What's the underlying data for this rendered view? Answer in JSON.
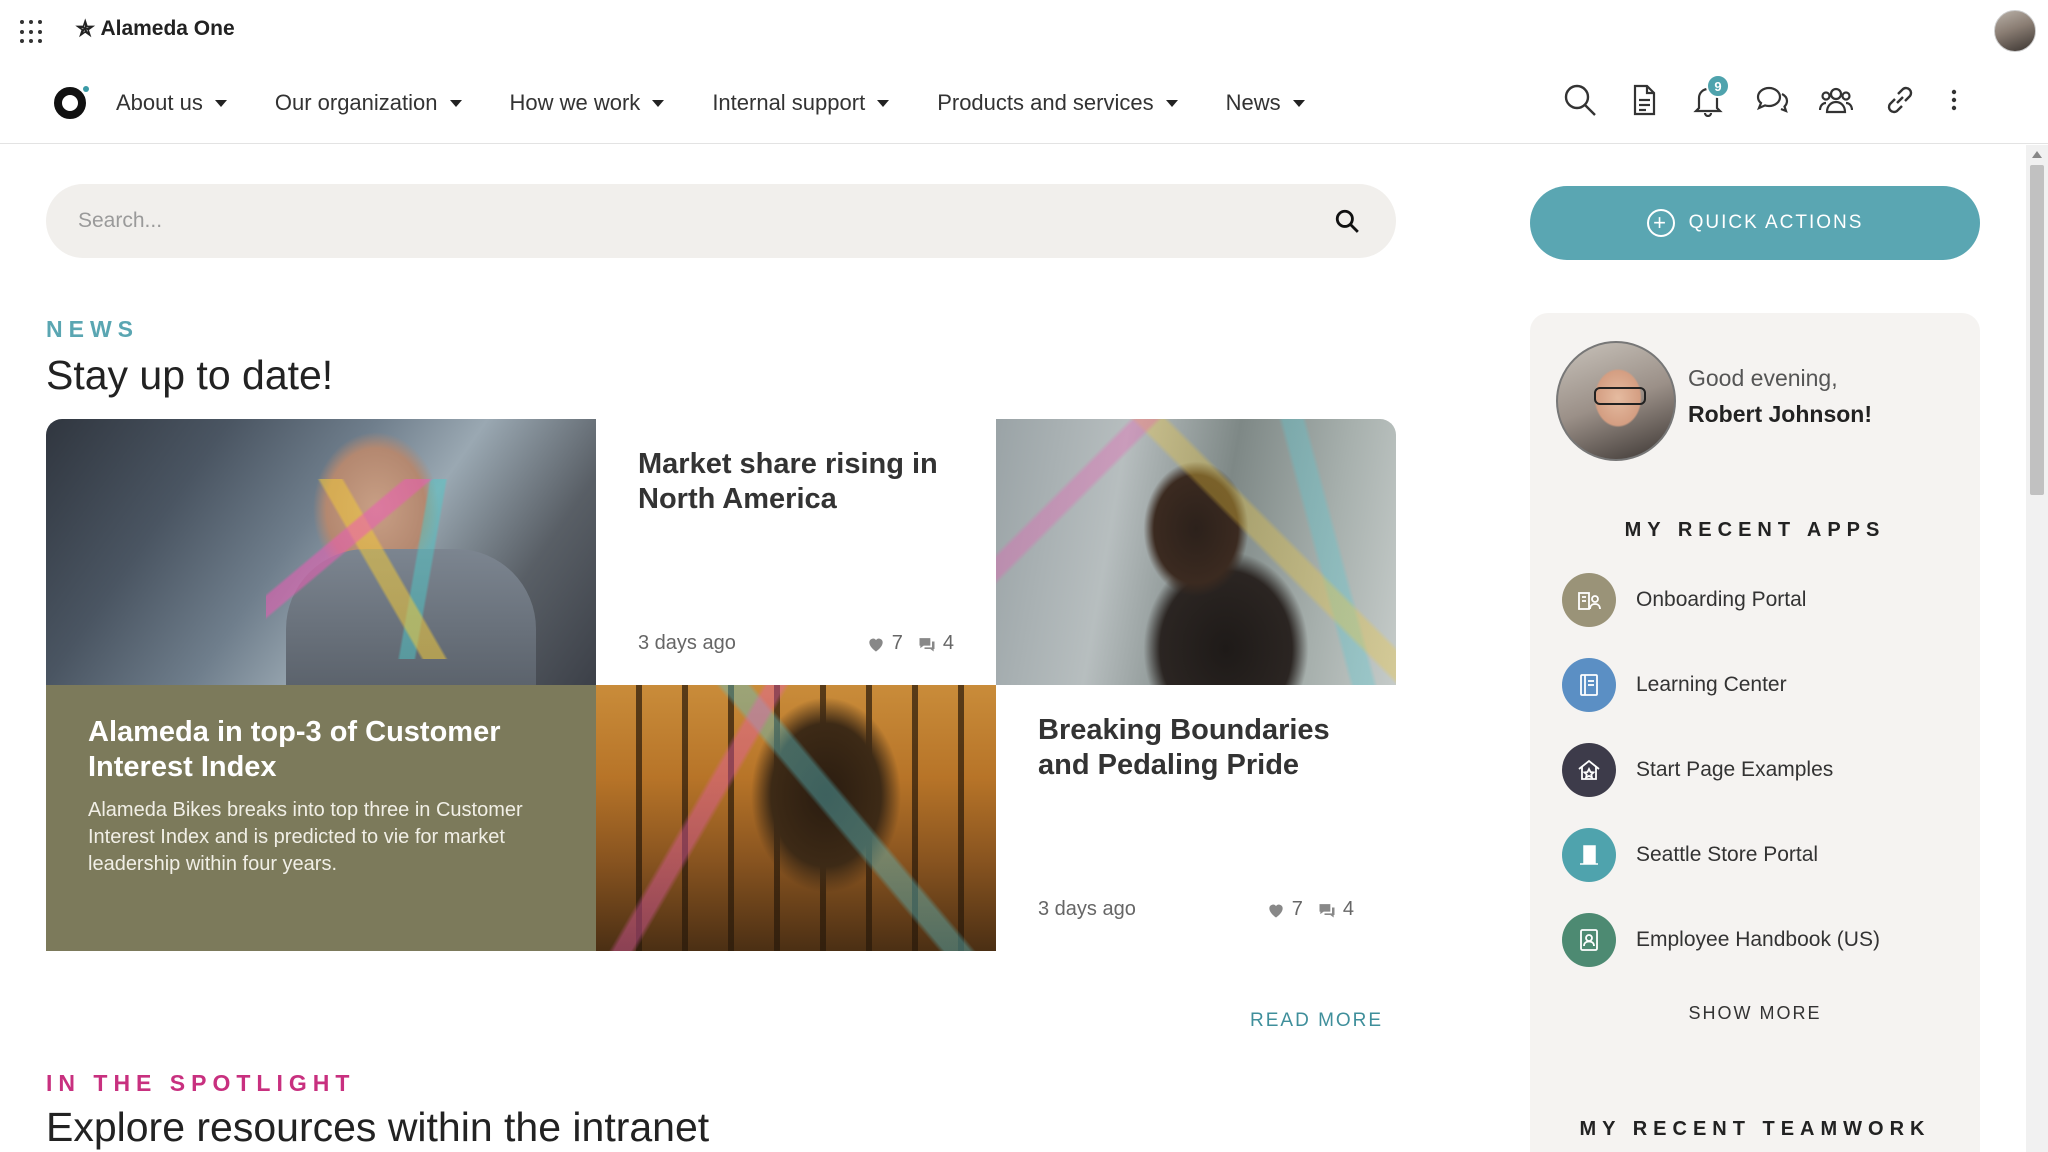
{
  "app": {
    "name": "Alameda One"
  },
  "nav": {
    "items": [
      {
        "label": "About us"
      },
      {
        "label": "Our organization"
      },
      {
        "label": "How we work"
      },
      {
        "label": "Internal support"
      },
      {
        "label": "Products and services"
      },
      {
        "label": "News"
      }
    ],
    "notifications_count": "9",
    "icons": [
      "search-icon",
      "document-icon",
      "bell-icon",
      "chat-icon",
      "people-icon",
      "link-icon",
      "more-icon"
    ]
  },
  "search": {
    "placeholder": "Search..."
  },
  "quick_actions": {
    "label": "QUICK ACTIONS"
  },
  "news": {
    "eyebrow": "NEWS",
    "title": "Stay up to date!",
    "cards": [
      {
        "title": "Market share rising in North America",
        "time": "3 days ago",
        "likes": "7",
        "comments": "4"
      },
      {
        "title": "Alameda in top-3 of Customer Interest Index",
        "description": "Alameda Bikes breaks into top three in Customer Interest Index and is predicted to vie for market leadership within four years."
      },
      {
        "title": "Breaking Boundaries and Pedaling Pride",
        "time": "3 days ago",
        "likes": "7",
        "comments": "4"
      }
    ],
    "read_more": "READ MORE"
  },
  "spotlight": {
    "eyebrow": "IN THE SPOTLIGHT",
    "title": "Explore resources within the intranet"
  },
  "sidebar": {
    "greeting": "Good evening,",
    "user_name": "Robert Johnson!",
    "recent_apps_heading": "MY RECENT APPS",
    "apps": [
      {
        "label": "Onboarding Portal",
        "color": "#9a9378"
      },
      {
        "label": "Learning Center",
        "color": "#5b8fc4"
      },
      {
        "label": "Start Page Examples",
        "color": "#3d3b4a"
      },
      {
        "label": "Seattle Store Portal",
        "color": "#4fa3ad"
      },
      {
        "label": "Employee Handbook (US)",
        "color": "#4d8a72"
      }
    ],
    "show_more": "SHOW MORE",
    "recent_teamwork_heading": "MY RECENT TEAMWORK"
  },
  "colors": {
    "accent": "#5aa6b2",
    "spotlight": "#c8307f",
    "olive": "#7c7a5b"
  }
}
